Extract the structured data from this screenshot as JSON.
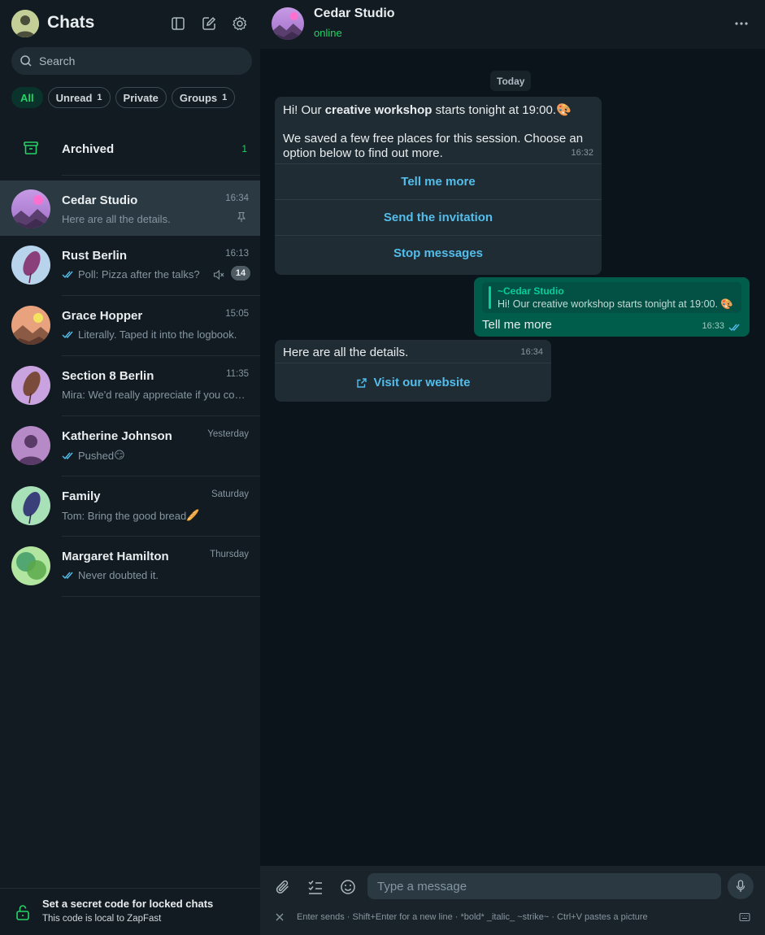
{
  "sidebar": {
    "title": "Chats",
    "search_placeholder": "Search",
    "filters": [
      {
        "label": "All",
        "count": ""
      },
      {
        "label": "Unread",
        "count": "1"
      },
      {
        "label": "Private",
        "count": ""
      },
      {
        "label": "Groups",
        "count": "1"
      }
    ],
    "archived": {
      "label": "Archived",
      "count": "1"
    },
    "chats": [
      {
        "name": "Cedar Studio",
        "time": "16:34",
        "preview": "Here are all the details."
      },
      {
        "name": "Rust Berlin",
        "time": "16:13",
        "preview": "Poll: Pizza after the talks?",
        "unread": "14"
      },
      {
        "name": "Grace Hopper",
        "time": "15:05",
        "preview": "Literally. Taped it into the logbook."
      },
      {
        "name": "Section 8 Berlin",
        "time": "11:35",
        "preview": "Mira: We'd really appreciate if you could join us"
      },
      {
        "name": "Katherine Johnson",
        "time": "Yesterday",
        "preview": "Pushed",
        "emoji": "😏"
      },
      {
        "name": "Family",
        "time": "Saturday",
        "preview": "Tom: Bring the good bread",
        "emoji": "🥖"
      },
      {
        "name": "Margaret Hamilton",
        "time": "Thursday",
        "preview": "Never doubted it."
      }
    ],
    "footer": {
      "title": "Set a secret code for locked chats",
      "subtitle": "This code is local to ZapFast"
    }
  },
  "chat": {
    "name": "Cedar Studio",
    "status": "online",
    "date_label": "Today",
    "messages": [
      {
        "pre": "Hi! Our ",
        "bold": "creative workshop",
        "post": " starts tonight at 19:00.",
        "emoji": "🎨",
        "body": "We saved a few free places for this session. Choose an option below to find out more.",
        "time": "16:32",
        "buttons": [
          "Tell me more",
          "Send the invitation",
          "Stop messages"
        ]
      },
      {
        "quote_author": "~Cedar Studio",
        "quote_text": "Hi! Our creative workshop starts tonight at 19:00. 🎨",
        "text": "Tell me more",
        "time": "16:33"
      },
      {
        "text": "Here are all the details.",
        "time": "16:34",
        "link_label": "Visit our website"
      }
    ]
  },
  "composer": {
    "placeholder": "Type a message",
    "hint": "Enter sends · Shift+Enter for a new line · *bold* _italic_ ~strike~ · Ctrl+V pastes a picture"
  },
  "colors": {
    "accent": "#25d366",
    "link": "#53bdeb",
    "outgoing_bubble": "#005c4b",
    "incoming_bubble": "#202c33"
  },
  "icons": [
    "sidebar-toggle-icon",
    "compose-icon",
    "settings-gear-icon",
    "search-icon",
    "archive-icon",
    "pin-icon",
    "mute-icon",
    "double-check-icon",
    "unlock-icon",
    "more-dots-icon",
    "external-link-icon",
    "paperclip-icon",
    "checklist-icon",
    "emoji-icon",
    "mic-icon",
    "close-icon",
    "keyboard-icon"
  ]
}
